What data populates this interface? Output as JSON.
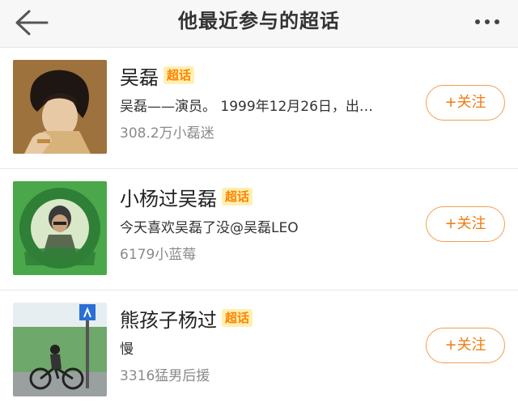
{
  "header": {
    "title": "他最近参与的超话",
    "back_icon": "back-arrow-icon",
    "more_icon": "more-dots-icon"
  },
  "topics": [
    {
      "name": "吴磊",
      "badge": "超话",
      "description": "吴磊——演员。 1999年12月26日，出…",
      "fans": "308.2万小磊迷",
      "follow_label": "+关注"
    },
    {
      "name": "小杨过吴磊",
      "badge": "超话",
      "description": "今天喜欢吴磊了没@吴磊LEO",
      "fans": "6179小蓝莓",
      "follow_label": "+关注"
    },
    {
      "name": "熊孩子杨过",
      "badge": "超话",
      "description": "慢",
      "fans": "3316猛男后援",
      "follow_label": "+关注"
    }
  ],
  "colors": {
    "accent": "#ee7c12",
    "badge_bg": "#fff0b0",
    "header_bg": "#f7f7f7"
  }
}
